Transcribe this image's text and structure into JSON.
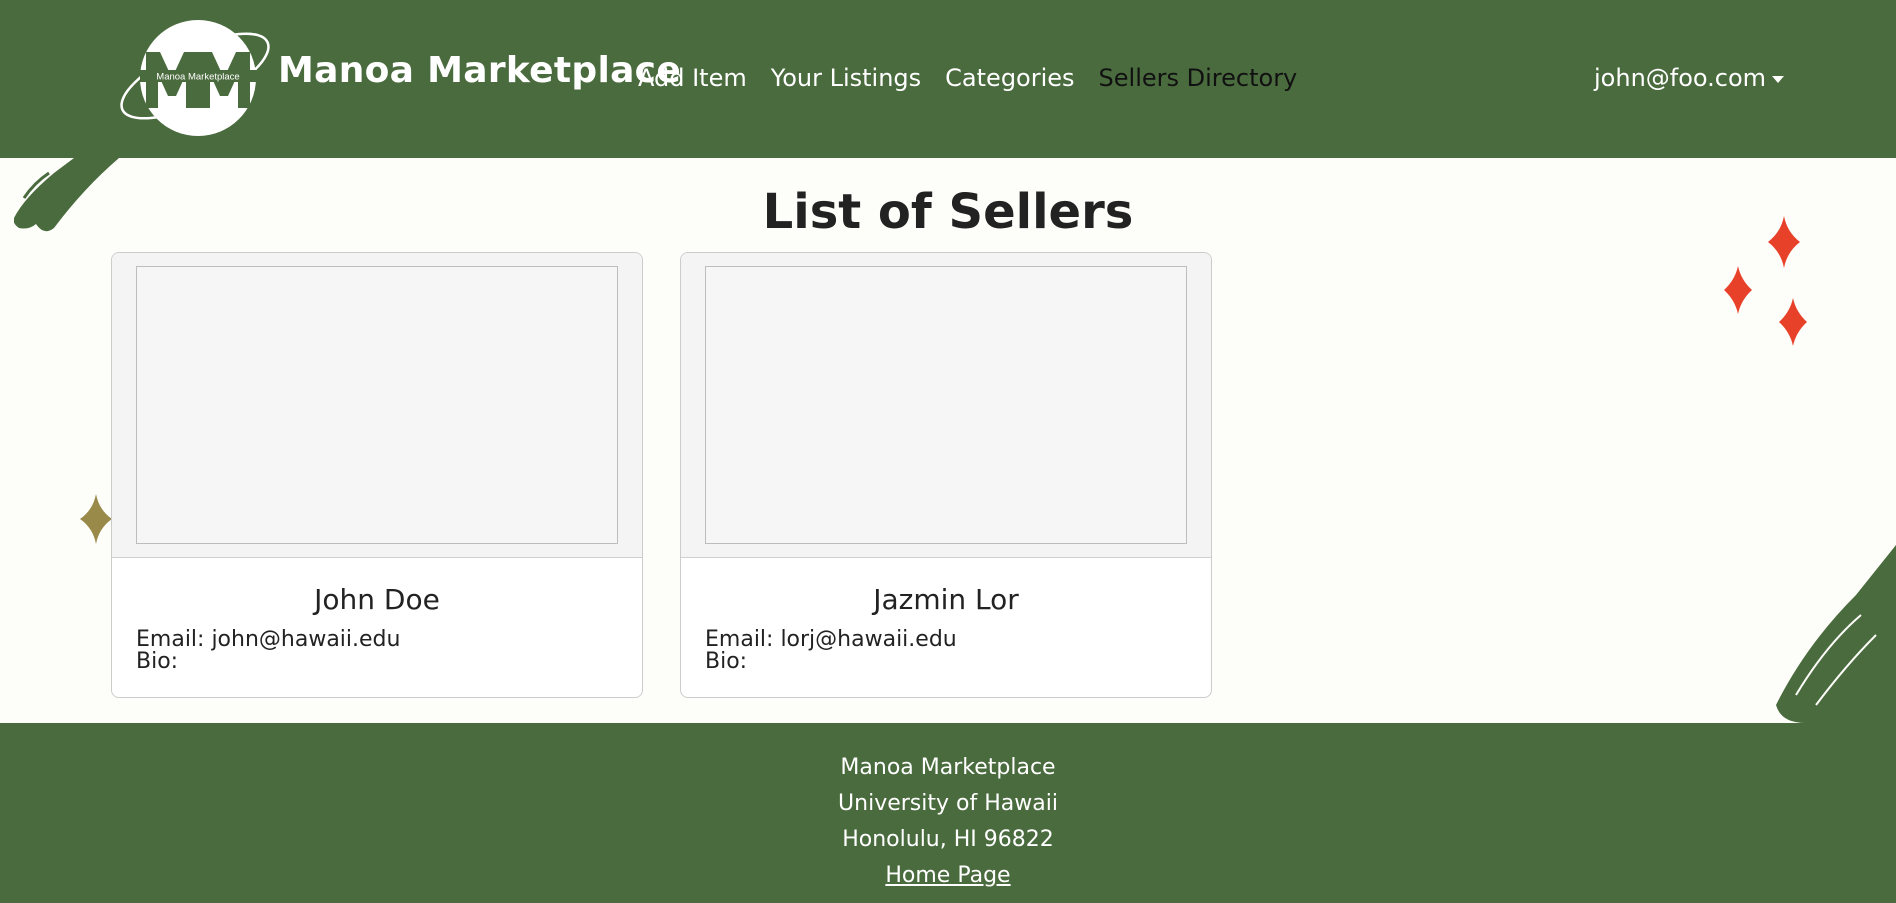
{
  "navbar": {
    "brand": "Manoa Marketplace",
    "logo_text": "Manoa Marketplace",
    "links": [
      "Add Item",
      "Your Listings",
      "Categories",
      "Sellers Directory"
    ],
    "active_link": "Sellers Directory",
    "user": "john@foo.com"
  },
  "main": {
    "title": "List of Sellers",
    "sellers": [
      {
        "name": "John Doe",
        "email": "Email: john@hawaii.edu",
        "bio": "Bio:"
      },
      {
        "name": "Jazmin Lor",
        "email": "Email: lorj@hawaii.edu",
        "bio": "Bio:"
      }
    ]
  },
  "footer": {
    "line1": "Manoa Marketplace",
    "line2": "University of Hawaii",
    "line3": "Honolulu, HI 96822",
    "home_link": "Home Page"
  },
  "colors": {
    "brand_green": "#4a6b3e",
    "sparkle_red": "#e8412a",
    "sparkle_olive": "#9a8a4a"
  }
}
